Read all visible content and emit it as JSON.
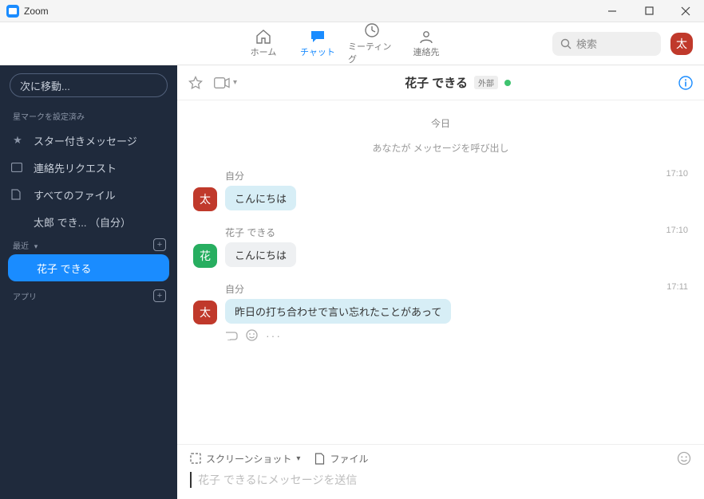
{
  "window": {
    "title": "Zoom"
  },
  "nav": {
    "tabs": [
      {
        "label": "ホーム",
        "icon": "home-icon"
      },
      {
        "label": "チャット",
        "icon": "chat-icon"
      },
      {
        "label": "ミーティング",
        "icon": "clock-icon"
      },
      {
        "label": "連絡先",
        "icon": "contacts-icon"
      }
    ],
    "search_placeholder": "検索",
    "me_avatar_glyph": "太"
  },
  "sidebar": {
    "jump_placeholder": "次に移動...",
    "section_starred": "星マークを設定済み",
    "items": [
      {
        "label": "スター付きメッセージ"
      },
      {
        "label": "連絡先リクエスト"
      },
      {
        "label": "すべてのファイル"
      },
      {
        "label": "太郎 でき...  （自分）"
      }
    ],
    "section_recent": "最近",
    "recent": [
      {
        "label": "花子 できる"
      }
    ],
    "section_apps": "アプリ"
  },
  "chat": {
    "header": {
      "title": "花子 できる",
      "badge": "外部"
    },
    "date_separator": "今日",
    "system_message": "あなたが メッセージを呼び出し",
    "messages": [
      {
        "sender": "自分",
        "avatar": "太",
        "avatar_color": "red",
        "time": "17:10",
        "text": "こんにちは",
        "kind": "me"
      },
      {
        "sender": "花子 できる",
        "avatar": "花",
        "avatar_color": "green",
        "time": "17:10",
        "text": "こんにちは",
        "kind": "other"
      },
      {
        "sender": "自分",
        "avatar": "太",
        "avatar_color": "red",
        "time": "17:11",
        "text": "昨日の打ち合わせで言い忘れたことがあって",
        "kind": "me"
      }
    ],
    "composer": {
      "screenshot_label": "スクリーンショット",
      "file_label": "ファイル",
      "placeholder": "花子 できるにメッセージを送信"
    }
  }
}
